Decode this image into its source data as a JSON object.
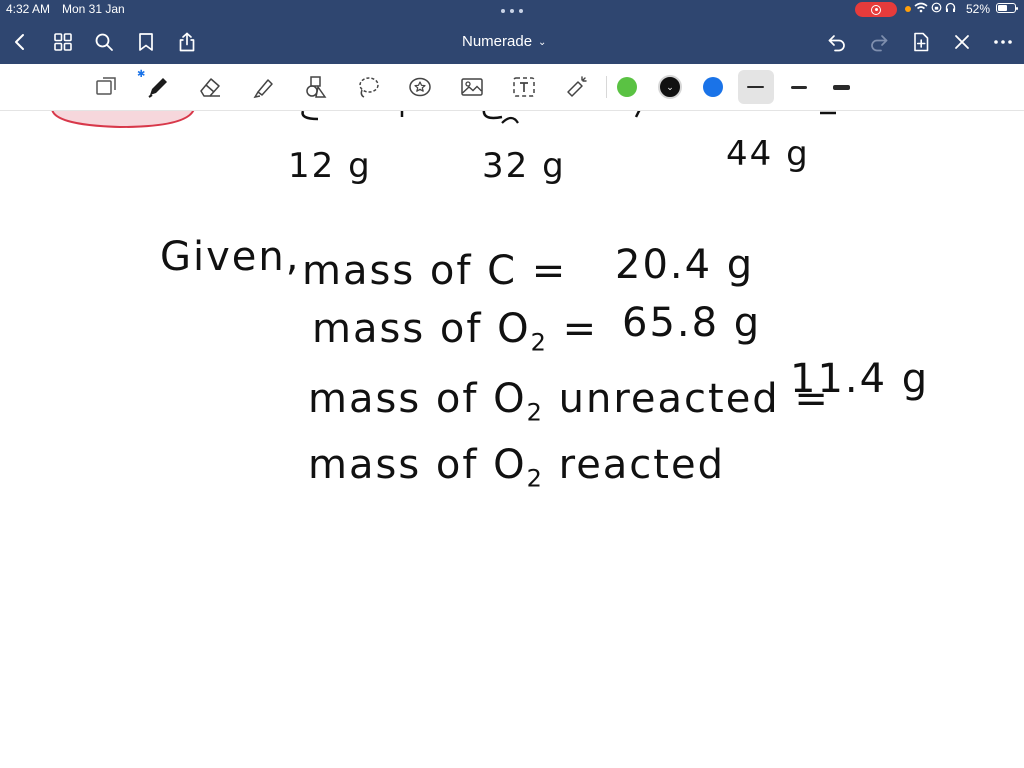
{
  "status_bar": {
    "time": "4:32 AM",
    "date": "Mon 31 Jan",
    "battery": "52%"
  },
  "nav_bar": {
    "title": "Numerade",
    "icons": [
      "back-icon",
      "grid-icon",
      "search-icon",
      "bookmark-icon",
      "share-icon",
      "undo-icon",
      "redo-icon",
      "add-page-icon",
      "close-icon",
      "more-icon"
    ]
  },
  "toolbar": {
    "tools": [
      "lasso-select-icon",
      "pen-icon",
      "eraser-icon",
      "highlighter-icon",
      "shapes-icon",
      "lasso-icon",
      "sticker-icon",
      "image-icon",
      "text-icon",
      "laser-pointer-icon"
    ],
    "colors": [
      "#5ac243",
      "#111111",
      "#1a73e8"
    ],
    "selected_color": "#111111",
    "stroke_widths": [
      "thin",
      "medium",
      "thick"
    ],
    "selected_stroke": "thin"
  },
  "note": {
    "equation_masses": [
      "12 g",
      "32 g",
      "44 g"
    ],
    "given_label": "Given,",
    "lines": [
      {
        "label": "mass of C =",
        "value": "20.4 g"
      },
      {
        "label": "mass of O2 =",
        "value": "65.8 g"
      },
      {
        "label": "mass of O2 unreacted =",
        "value": "11.4 g"
      },
      {
        "label": "mass of O2 reacted",
        "value": ""
      }
    ]
  }
}
